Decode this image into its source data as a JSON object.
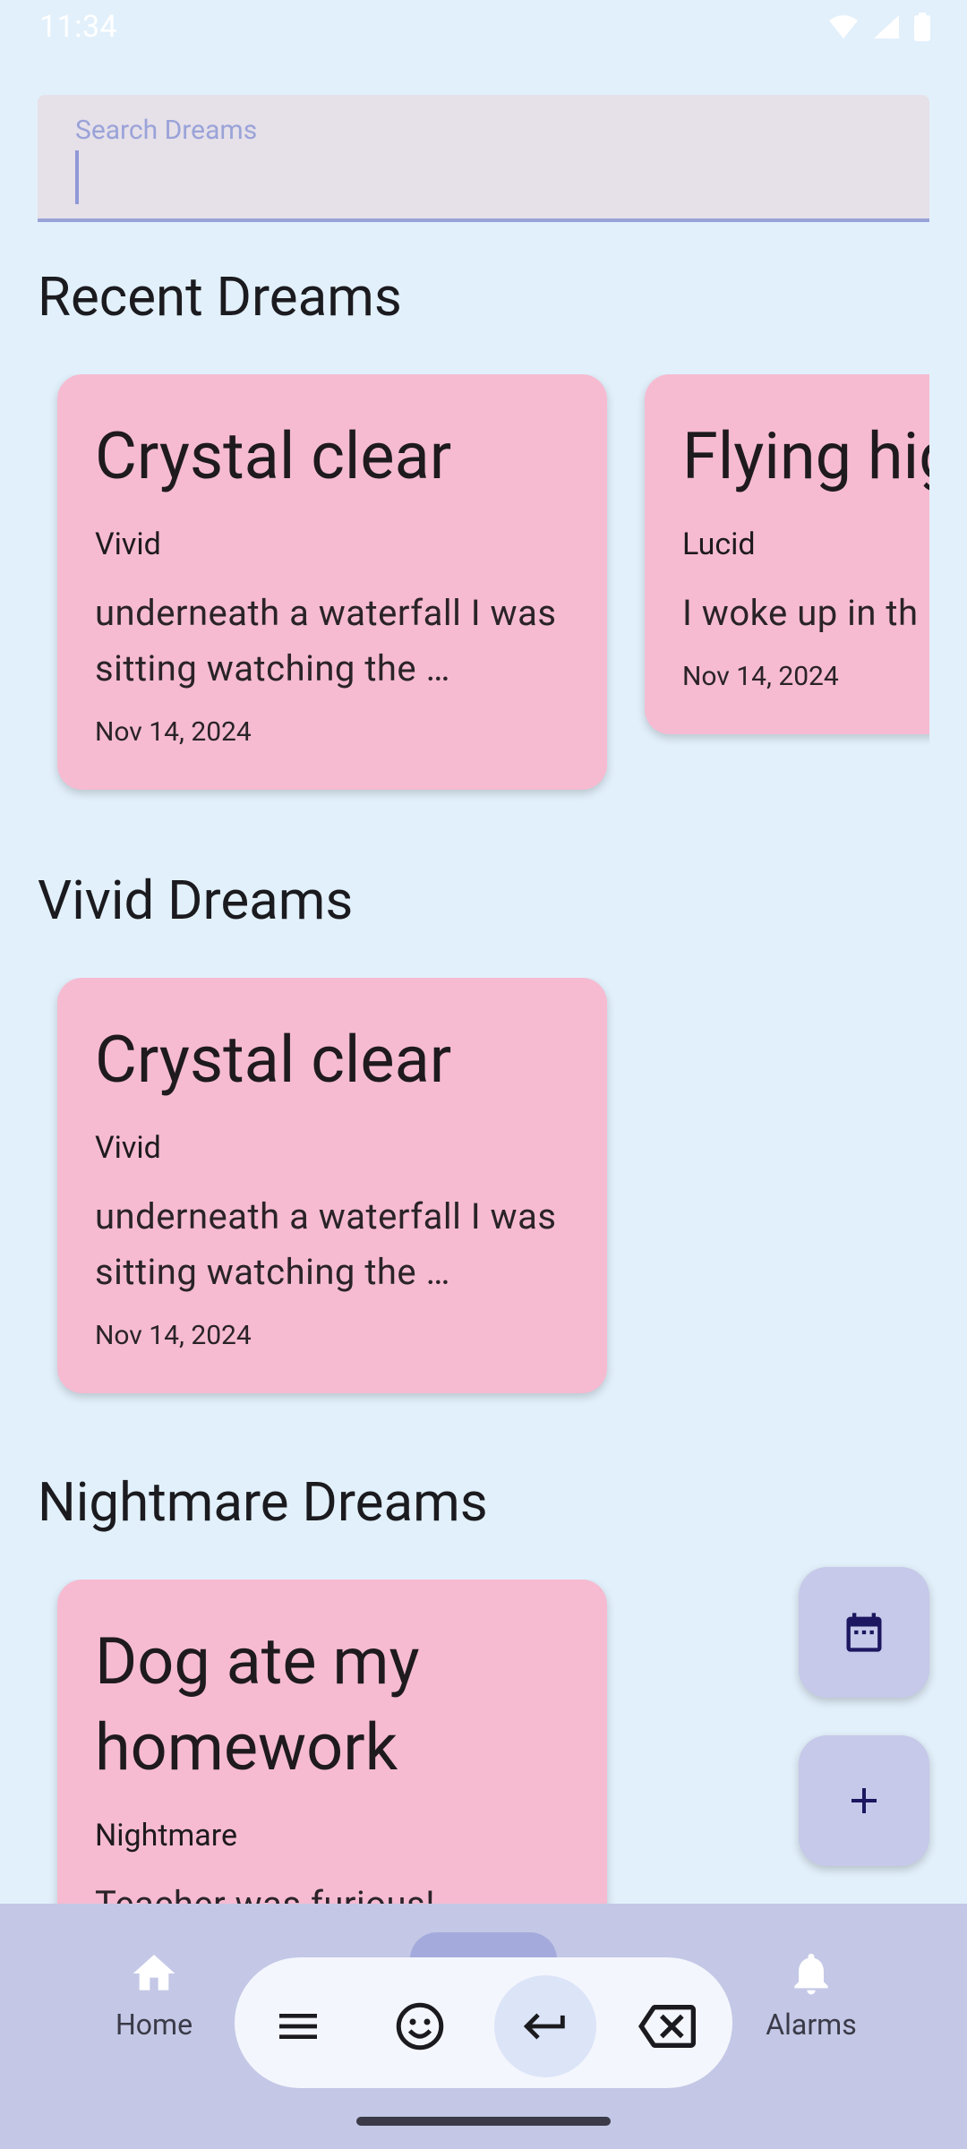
{
  "status": {
    "time": "11:34"
  },
  "search": {
    "label": "Search Dreams"
  },
  "sections": {
    "recent": {
      "title": "Recent Dreams",
      "cards": [
        {
          "title": "Crystal clear",
          "category": "Vivid",
          "body": "underneath a waterfall I was sitting watching the …",
          "date": "Nov 14, 2024"
        },
        {
          "title": "Flying hig",
          "category": "Lucid",
          "body": "I woke up in th",
          "date": "Nov 14, 2024"
        }
      ]
    },
    "vivid": {
      "title": "Vivid Dreams",
      "cards": [
        {
          "title": "Crystal clear",
          "category": "Vivid",
          "body": "underneath a waterfall I was sitting watching the …",
          "date": "Nov 14, 2024"
        }
      ]
    },
    "nightmare": {
      "title": "Nightmare Dreams",
      "cards": [
        {
          "title": "Dog ate my homework",
          "category": "Nightmare",
          "body": "Teacher was furious!"
        }
      ]
    }
  },
  "fabs": {
    "calendar_icon": "calendar-icon",
    "add_icon": "plus-icon"
  },
  "nav": {
    "items": [
      {
        "label": "Home",
        "icon": "home-icon"
      },
      {
        "label": "Alarms",
        "icon": "bell-icon"
      }
    ]
  },
  "keyboard_bar": {
    "icons": [
      "menu-icon",
      "emoji-icon",
      "enter-icon",
      "backspace-icon"
    ]
  },
  "colors": {
    "background": "#E2F0FB",
    "card": "#F6BBD1",
    "fab": "#C6C9E9",
    "nav": "#C4C8E6",
    "accent": "#9aa3d8"
  }
}
